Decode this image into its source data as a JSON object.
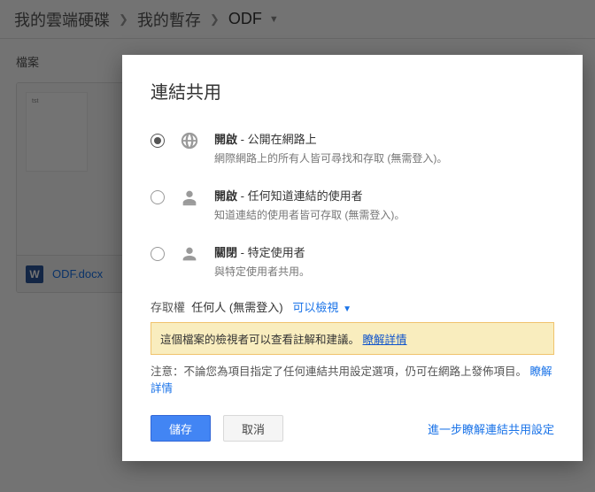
{
  "breadcrumb": {
    "items": [
      "我的雲端硬碟",
      "我的暫存",
      "ODF"
    ]
  },
  "content": {
    "sectionLabel": "檔案",
    "file": {
      "name": "ODF.docx",
      "iconLetter": "W"
    }
  },
  "dialog": {
    "title": "連結共用",
    "options": [
      {
        "titleBold": "開啟",
        "titleRest": " - 公開在網路上",
        "sub": "網際網路上的所有人皆可尋找和存取 (無需登入)。",
        "selected": true,
        "icon": "globe"
      },
      {
        "titleBold": "開啟",
        "titleRest": " - 任何知道連結的使用者",
        "sub": "知道連結的使用者皆可存取 (無需登入)。",
        "selected": false,
        "icon": "person-link"
      },
      {
        "titleBold": "關閉",
        "titleRest": " - 特定使用者",
        "sub": "與特定使用者共用。",
        "selected": false,
        "icon": "person"
      }
    ],
    "access": {
      "label": "存取權",
      "who": "任何人 (無需登入)",
      "permission": "可以檢視"
    },
    "tip": {
      "text": "這個檔案的檢視者可以查看註解和建議。",
      "link": "瞭解詳情"
    },
    "note": {
      "text": "注意：不論您為項目指定了任何連結共用設定選項，仍可在網路上發佈項目。",
      "link": "瞭解詳情"
    },
    "buttons": {
      "save": "儲存",
      "cancel": "取消",
      "more": "進一步瞭解連結共用設定"
    }
  }
}
